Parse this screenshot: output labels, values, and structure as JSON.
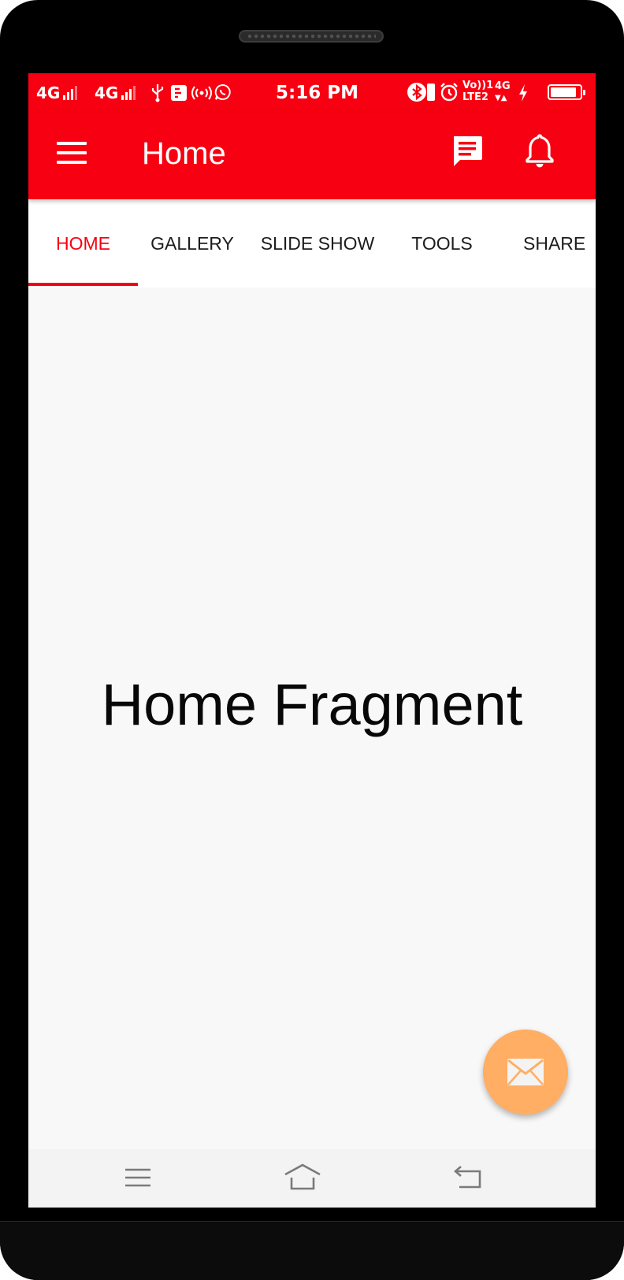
{
  "status_bar": {
    "sim1_network": "4G",
    "sim2_network": "4G",
    "volte": "Vo))1",
    "lte": "LTE2",
    "network_small": "4G",
    "time": "5:16 PM",
    "battery_level": 0.9,
    "icons": [
      "signal-icon",
      "signal-icon",
      "usb-icon",
      "notification-icon",
      "hotspot-icon",
      "whatsapp-icon",
      "bluetooth-icon",
      "vibrate-icon",
      "alarm-icon",
      "charging-icon",
      "battery-icon"
    ]
  },
  "toolbar": {
    "title": "Home",
    "background": "#f70011",
    "icons": [
      "menu-icon",
      "chat-icon",
      "notification-bell-icon"
    ]
  },
  "tabs": [
    {
      "label": "HOME",
      "active": true
    },
    {
      "label": "GALLERY",
      "active": false
    },
    {
      "label": "SLIDE SHOW",
      "active": false
    },
    {
      "label": "TOOLS",
      "active": false
    },
    {
      "label": "SHARE",
      "active": false
    }
  ],
  "content": {
    "text": "Home Fragment"
  },
  "fab": {
    "icon": "mail-icon",
    "color": "#ffae63"
  },
  "nav_bar": {
    "icons": [
      "recent-apps-icon",
      "home-icon",
      "back-icon"
    ]
  },
  "colors": {
    "accent": "#f70011",
    "fab": "#ffae63",
    "content_background": "#f8f8f8"
  }
}
